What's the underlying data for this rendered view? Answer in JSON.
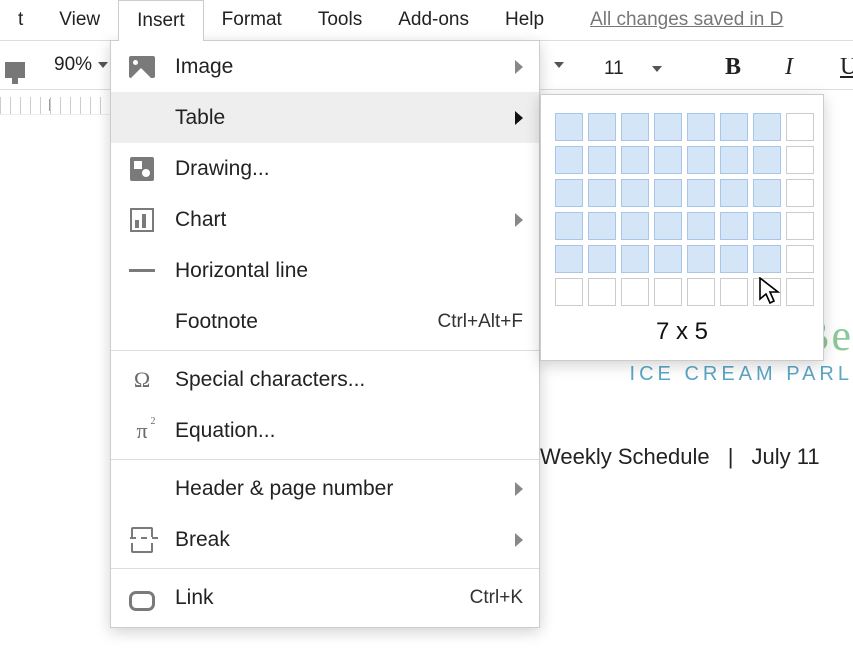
{
  "menubar": {
    "items": [
      "t",
      "View",
      "Insert",
      "Format",
      "Tools",
      "Add-ons",
      "Help"
    ],
    "saved_text": "All changes saved in D"
  },
  "toolbar": {
    "zoom": "90%",
    "fontsize": "11",
    "bold": "B",
    "italic": "I",
    "underline": "U"
  },
  "insert_menu": {
    "items": [
      {
        "label": "Image",
        "has_submenu": true
      },
      {
        "label": "Table",
        "has_submenu": true,
        "highlighted": true
      },
      {
        "label": "Drawing..."
      },
      {
        "label": "Chart",
        "has_submenu": true
      },
      {
        "label": "Horizontal line"
      },
      {
        "label": "Footnote",
        "shortcut": "Ctrl+Alt+F"
      },
      {
        "label": "Special characters..."
      },
      {
        "label": "Equation..."
      },
      {
        "label": "Header & page number",
        "has_submenu": true
      },
      {
        "label": "Break",
        "has_submenu": true
      },
      {
        "label": "Link",
        "shortcut": "Ctrl+K"
      }
    ]
  },
  "table_picker": {
    "cols": 7,
    "rows": 5,
    "label": "7 x 5"
  },
  "document": {
    "brand_visible": "Be",
    "tagline_visible": "ICE CREAM PARL",
    "schedule_label": "Weekly Schedule",
    "schedule_date": "July 11"
  }
}
